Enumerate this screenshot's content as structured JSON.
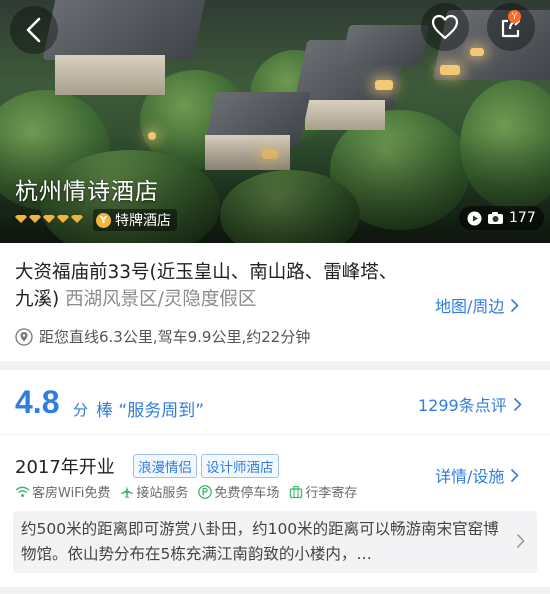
{
  "hero": {
    "hotel_name": "杭州情诗酒店",
    "brand_badge": "特牌酒店",
    "brand_badge_icon": "y-coin-icon",
    "diamond_count": 5,
    "photo_count": "177",
    "share_badge": "Y",
    "icons": {
      "back": "chevron-left-icon",
      "favorite": "heart-icon",
      "share": "share-icon",
      "video": "play-icon",
      "camera": "camera-icon"
    }
  },
  "address": {
    "street": "大资福庙前33号(近玉皇山、南山路、雷峰塔、九溪)",
    "area": "西湖风景区/灵隐度假区",
    "map_link": "地图/周边",
    "distance": "距您直线6.3公里,驾车9.9公里,约22分钟"
  },
  "rating": {
    "score": "4.8",
    "unit": "分",
    "comment": "棒 “服务周到”",
    "reviews_link": "1299条点评"
  },
  "info": {
    "opened": "2017年开业",
    "tags": [
      "浪漫情侣",
      "设计师酒店"
    ],
    "detail_link": "详情/设施",
    "facilities": [
      "客房WiFi免费",
      "接站服务",
      "免费停车场",
      "行李寄存"
    ],
    "description": "约500米的距离即可游赏八卦田，约100米的距离可以畅游南宋官窑博物馆。依山势分布在5栋充满江南韵致的小楼内，…"
  },
  "colors": {
    "accent": "#2f7de0",
    "diamond": "#f2b43a",
    "facility_green": "#3fb86b"
  }
}
